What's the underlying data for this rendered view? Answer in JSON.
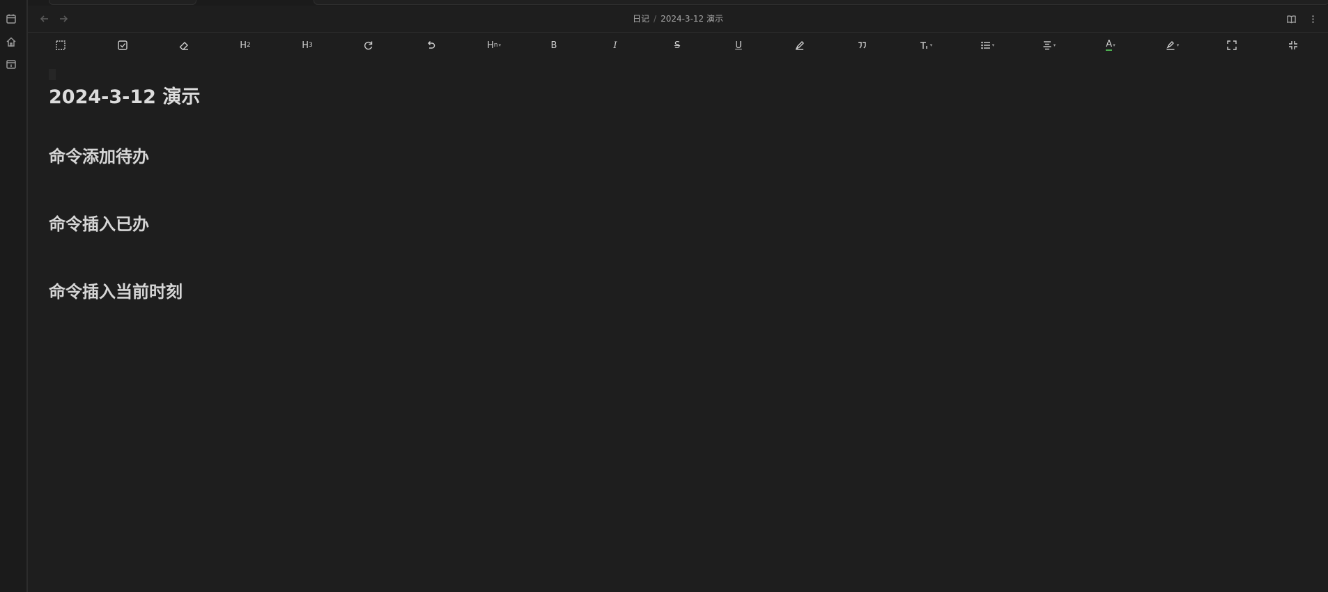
{
  "ribbon": {
    "icons": [
      "calendar-icon",
      "home-icon",
      "daily-note-icon"
    ]
  },
  "header": {
    "breadcrumb_parent": "日记",
    "breadcrumb_separator": "/",
    "breadcrumb_current": "2024-3-12 演示"
  },
  "toolbar": {
    "items": [
      {
        "name": "select-block",
        "label": ""
      },
      {
        "name": "checkbox",
        "label": ""
      },
      {
        "name": "eraser",
        "label": ""
      },
      {
        "name": "heading-2",
        "label": "H",
        "sub": "2"
      },
      {
        "name": "heading-3",
        "label": "H",
        "sub": "3"
      },
      {
        "name": "redo",
        "label": ""
      },
      {
        "name": "undo",
        "label": ""
      },
      {
        "name": "heading-n",
        "label": "H",
        "sub": "n"
      },
      {
        "name": "bold",
        "label": "B"
      },
      {
        "name": "italic",
        "label": "I"
      },
      {
        "name": "strikethrough",
        "label": "S"
      },
      {
        "name": "underline",
        "label": "U"
      },
      {
        "name": "highlight-pen",
        "label": ""
      },
      {
        "name": "quote",
        "label": ""
      },
      {
        "name": "text-format",
        "label": ""
      },
      {
        "name": "list",
        "label": ""
      },
      {
        "name": "align",
        "label": ""
      },
      {
        "name": "font-color",
        "label": "A"
      },
      {
        "name": "highlight-color",
        "label": ""
      },
      {
        "name": "fullscreen",
        "label": ""
      },
      {
        "name": "exit-fullscreen",
        "label": ""
      }
    ]
  },
  "document": {
    "title": "2024-3-12 演示",
    "headings": [
      "命令添加待办",
      "命令插入已办",
      "命令插入当前时刻"
    ]
  },
  "colors": {
    "background": "#1e1e1e",
    "ribbon": "#1b1b1b",
    "text": "#dadada",
    "font_color_underline": "#4caf50"
  }
}
